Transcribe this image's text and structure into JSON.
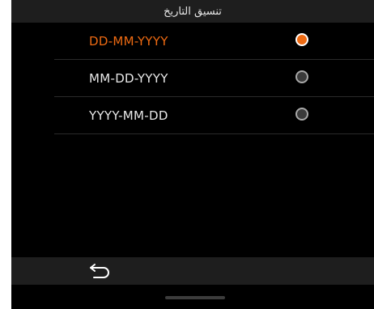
{
  "header": {
    "title": "تنسيق التاريخ"
  },
  "options": [
    {
      "label": "DD-MM-YYYY",
      "selected": true
    },
    {
      "label": "MM-DD-YYYY",
      "selected": false
    },
    {
      "label": "YYYY-MM-DD",
      "selected": false
    }
  ],
  "colors": {
    "accent": "#ee6a12",
    "background": "#000000",
    "bar": "#1e1e1e"
  },
  "icons": {
    "back": "back-arrow-icon"
  }
}
